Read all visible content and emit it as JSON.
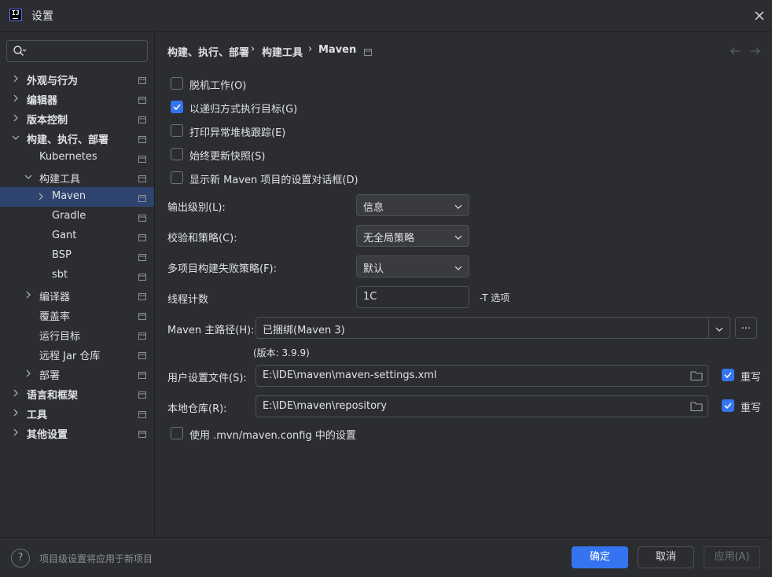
{
  "window": {
    "title": "设置"
  },
  "sidebar": {
    "items": [
      {
        "label": "外观与行为",
        "bold": true,
        "level": 0,
        "chevron": "right"
      },
      {
        "label": "编辑器",
        "bold": true,
        "level": 0,
        "chevron": "right"
      },
      {
        "label": "版本控制",
        "bold": true,
        "level": 0,
        "chevron": "right"
      },
      {
        "label": "构建、执行、部署",
        "bold": true,
        "level": 0,
        "chevron": "down"
      },
      {
        "label": "Kubernetes",
        "bold": false,
        "level": 1,
        "chevron": "none"
      },
      {
        "label": "构建工具",
        "bold": false,
        "level": 1,
        "chevron": "down"
      },
      {
        "label": "Maven",
        "bold": false,
        "level": 2,
        "chevron": "right",
        "selected": true
      },
      {
        "label": "Gradle",
        "bold": false,
        "level": 2,
        "chevron": "none"
      },
      {
        "label": "Gant",
        "bold": false,
        "level": 2,
        "chevron": "none"
      },
      {
        "label": "BSP",
        "bold": false,
        "level": 2,
        "chevron": "none"
      },
      {
        "label": "sbt",
        "bold": false,
        "level": 2,
        "chevron": "none"
      },
      {
        "label": "编译器",
        "bold": false,
        "level": 1,
        "chevron": "right"
      },
      {
        "label": "覆盖率",
        "bold": false,
        "level": 1,
        "chevron": "none"
      },
      {
        "label": "运行目标",
        "bold": false,
        "level": 1,
        "chevron": "none"
      },
      {
        "label": "远程 Jar 仓库",
        "bold": false,
        "level": 1,
        "chevron": "none"
      },
      {
        "label": "部署",
        "bold": false,
        "level": 1,
        "chevron": "right"
      },
      {
        "label": "语言和框架",
        "bold": true,
        "level": 0,
        "chevron": "right"
      },
      {
        "label": "工具",
        "bold": true,
        "level": 0,
        "chevron": "right"
      },
      {
        "label": "其他设置",
        "bold": true,
        "level": 0,
        "chevron": "right"
      }
    ]
  },
  "breadcrumb": {
    "parts": [
      "构建、执行、部署",
      "构建工具",
      "Maven"
    ],
    "separator": "›"
  },
  "options": {
    "offline": {
      "label": "脱机工作(O)",
      "checked": false
    },
    "recursive": {
      "label": "以递归方式执行目标(G)",
      "checked": true
    },
    "print_stack": {
      "label": "打印异常堆栈跟踪(E)",
      "checked": false
    },
    "always_update": {
      "label": "始终更新快照(S)",
      "checked": false
    },
    "show_dialog": {
      "label": "显示新 Maven 项目的设置对话框(D)",
      "checked": false
    },
    "use_mvn_config": {
      "label": "使用 .mvn/maven.config 中的设置",
      "checked": false
    }
  },
  "fields": {
    "output_level": {
      "label": "输出级别(L):",
      "value": "信息"
    },
    "checksum_policy": {
      "label": "校验和策略(C):",
      "value": "无全局策略"
    },
    "fail_policy": {
      "label": "多项目构建失败策略(F):",
      "value": "默认"
    },
    "thread_count": {
      "label": "线程计数",
      "value": "1C",
      "suffix": "-T 选项"
    },
    "maven_home": {
      "label": "Maven 主路径(H):",
      "value": "已捆绑(Maven 3)",
      "browse": "...",
      "version": "(版本: 3.9.9)"
    },
    "user_settings": {
      "label": "用户设置文件(S):",
      "value": "E:\\IDE\\maven\\maven-settings.xml",
      "override_label": "重写",
      "override": true
    },
    "local_repo": {
      "label": "本地仓库(R):",
      "value": "E:\\IDE\\maven\\repository",
      "override_label": "重写",
      "override": true
    }
  },
  "footer": {
    "hint": "项目级设置将应用于新项目",
    "help": "?",
    "ok": "确定",
    "cancel": "取消",
    "apply": "应用(A)"
  },
  "colors": {
    "accent": "#3574f0",
    "selection": "#2e436e",
    "background": "#2b2d30"
  }
}
